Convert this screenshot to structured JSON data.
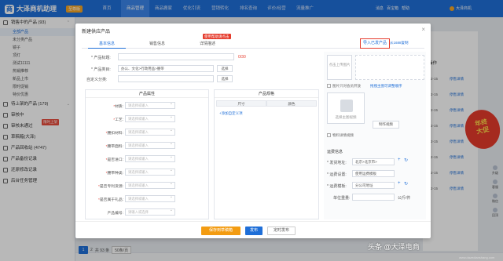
{
  "app": {
    "name": "大泽商机助理",
    "vip": "至尊版"
  },
  "nav": [
    "首页",
    "商品管理",
    "商品搬家",
    "优化引流",
    "营销转化",
    "排名查询",
    "评价/经营",
    "流量推广"
  ],
  "topbar": {
    "items": [
      "消息",
      "百宝箱",
      "帮助"
    ],
    "user": "大泽商机"
  },
  "sidebar": {
    "sections": [
      {
        "label": "销售中的产品 (93)",
        "subs": [
          "全部产品",
          "未分类产品",
          "镜子",
          "顶灯",
          "测试11111",
          "热销推荐",
          "新品上市",
          "限时促销",
          "特价优惠"
        ]
      },
      {
        "label": "待上架的产品 (179)"
      },
      {
        "label": "审核中"
      },
      {
        "label": "审核未通过",
        "tag": "限时上架"
      },
      {
        "label": "草稿箱(大泽)"
      },
      {
        "label": "产品回收站 (4747)"
      },
      {
        "label": "产品备份记录"
      },
      {
        "label": "还原修改记录"
      },
      {
        "label": "后台任务管理"
      }
    ]
  },
  "rightcol": {
    "header": "操作",
    "rows": [
      {
        "time": "21-12-15",
        "link": "停售详情"
      },
      {
        "time": "21-12-15",
        "link": "停售详情"
      },
      {
        "time": "21-12-15",
        "link": "停售详情"
      },
      {
        "time": "21-12-15",
        "link": "停售详情"
      },
      {
        "time": "21-12-15",
        "link": "停售详情"
      },
      {
        "time": "21-12-15",
        "link": "停售详情"
      },
      {
        "time": "21-12-15",
        "link": "停售详情"
      },
      {
        "time": "21-12-15",
        "link": "停售详情"
      }
    ]
  },
  "promo": {
    "line1": "年终",
    "line2": "大促"
  },
  "sidetools": [
    "升级",
    "客服",
    "微信",
    "回顶"
  ],
  "pager": {
    "page": "1",
    "next": "2",
    "total": "共 93 条",
    "size": "50条/页"
  },
  "modal": {
    "title": "新建供应产品",
    "tabs": [
      "基本信息",
      "销售信息",
      "详情描述"
    ],
    "badge": "使用帮助请点击",
    "import_button": "导入已发产品",
    "import_link": "从1688复制",
    "fields": {
      "title_label": "* 产品标题:",
      "title_count": "0/30",
      "category_label": "* 产品类目:",
      "category_value": "办公、文化>行政用品>腰带",
      "category_button": "选择",
      "custom_label": "自定义分类:",
      "custom_button": "选择"
    },
    "attr_panel": {
      "header": "产品属性",
      "rows": [
        {
          "label": "材质:",
          "req": true,
          "ph": "请选择或输入"
        },
        {
          "label": "工艺:",
          "req": true,
          "ph": "请选择或输入"
        },
        {
          "label": "腰扣材料:",
          "req": true,
          "ph": "请选择或输入"
        },
        {
          "label": "腰带面料:",
          "req": true,
          "ph": "请选择或输入"
        },
        {
          "label": "是否进口:",
          "req": true,
          "ph": "请选择或输入"
        },
        {
          "label": "腰带种类:",
          "req": true,
          "ph": "请选择或输入"
        },
        {
          "label": "是否专利货源:",
          "req": true,
          "ph": "请选择或输入"
        },
        {
          "label": "是否属于礼品:",
          "req": true,
          "ph": "请选择或输入"
        },
        {
          "label": "产品编号:",
          "req": false,
          "ph": "请输入或选择"
        }
      ]
    },
    "spec_panel": {
      "header": "产品规格",
      "col1": "尺寸",
      "col2": "颜色",
      "add": "+添加自定义项"
    },
    "images": {
      "add_main": "点击上传图片",
      "checkbox1": "图片只对会员开放",
      "link1": "拖拽主图可调整顺序",
      "video_add": "选择主图视频",
      "video_make": "制作视频",
      "checkbox2": "物料详情视频"
    },
    "logistics": {
      "title": "运费信息",
      "ship_from_label": "* 发货地址:",
      "ship_from": "北京>北京市>",
      "freight_label": "* 运费设置:",
      "freight": "使用运费模板",
      "template_label": "* 运费模板:",
      "template": "分公司地址",
      "weight_label": "单位重量:",
      "weight_unit": "公斤/件"
    },
    "footer": {
      "save": "保存到草稿箱",
      "publish": "发布",
      "timed": "定时发布"
    }
  },
  "watermark": {
    "text": "头条 @大泽电商",
    "sub": "www.dazedianshang.com"
  }
}
